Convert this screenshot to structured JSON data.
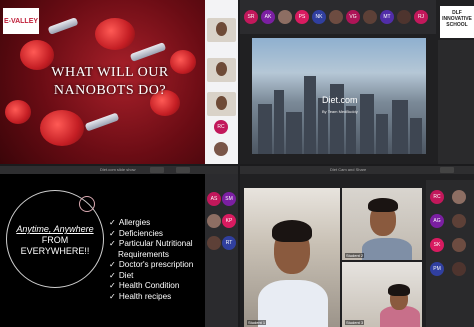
{
  "q1": {
    "logo_text": "E-VALLEY",
    "slide_title": "WHAT WILL OUR NANOBOTS DO?",
    "avatars": [
      {
        "initials": "RC",
        "color": "#c2185b"
      },
      {
        "initials": "",
        "color": "#795548"
      }
    ]
  },
  "q2": {
    "side_logo": "DLF INNOVATIVE SCHOOL",
    "slide_title": "Diet.com",
    "slide_subtitle": "By Team MedBuddy",
    "avatars": [
      {
        "initials": "SR",
        "color": "#c2185b"
      },
      {
        "initials": "AK",
        "color": "#7b1fa2"
      },
      {
        "initials": "",
        "color": "#8d6e63"
      },
      {
        "initials": "PS",
        "color": "#d81b60"
      },
      {
        "initials": "NK",
        "color": "#303f9f"
      },
      {
        "initials": "",
        "color": "#6d4c41"
      },
      {
        "initials": "VG",
        "color": "#ad1457"
      },
      {
        "initials": "",
        "color": "#5d4037"
      },
      {
        "initials": "MT",
        "color": "#512da8"
      },
      {
        "initials": "",
        "color": "#4e342e"
      },
      {
        "initials": "RJ",
        "color": "#c2185b"
      }
    ]
  },
  "q3": {
    "bar_title": "Diet.com slide show",
    "tagline_italic": "Anytime, Anywhere",
    "tagline_rest": "FROM EVERYWHERE!!",
    "bullets": [
      "Allergies",
      "Deficiencies",
      "Particular Nutritional",
      "Requirements",
      "Doctor's prescription",
      "Diet",
      "Health Condition",
      "Health recipes"
    ],
    "bullet_checks": [
      true,
      true,
      true,
      false,
      true,
      true,
      true,
      true
    ],
    "avatars": [
      {
        "initials": "AS",
        "color": "#c2185b"
      },
      {
        "initials": "SM",
        "color": "#7b1fa2"
      },
      {
        "initials": "",
        "color": "#8d6e63"
      },
      {
        "initials": "KP",
        "color": "#d81b60"
      },
      {
        "initials": "",
        "color": "#5d4037"
      },
      {
        "initials": "RT",
        "color": "#303f9f"
      }
    ]
  },
  "q4": {
    "bar_title": "Diet Cam and Share",
    "participants": [
      {
        "name": "Student 1"
      },
      {
        "name": "Student 2"
      },
      {
        "name": "Student 3"
      }
    ],
    "avatars": [
      {
        "initials": "RC",
        "color": "#c2185b"
      },
      {
        "initials": "",
        "color": "#8d6e63"
      },
      {
        "initials": "AG",
        "color": "#7b1fa2"
      },
      {
        "initials": "",
        "color": "#5d4037"
      },
      {
        "initials": "SK",
        "color": "#d81b60"
      },
      {
        "initials": "",
        "color": "#6d4c41"
      },
      {
        "initials": "PM",
        "color": "#303f9f"
      },
      {
        "initials": "",
        "color": "#4e342e"
      }
    ]
  }
}
